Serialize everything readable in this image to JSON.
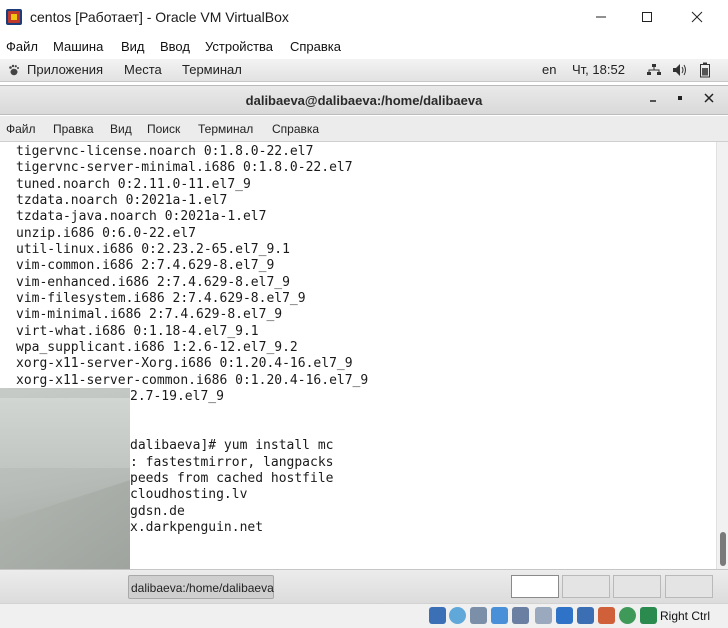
{
  "vbox": {
    "title": "centos [Работает] - Oracle VM VirtualBox",
    "menu": [
      "Файл",
      "Машина",
      "Вид",
      "Ввод",
      "Устройства",
      "Справка"
    ],
    "host_key": "Right Ctrl"
  },
  "gnome_panel": {
    "applications": "Приложения",
    "places": "Места",
    "terminal": "Терминал",
    "language": "en",
    "clock": "Чт, 18:52"
  },
  "terminal": {
    "title": "dalibaeva@dalibaeva:/home/dalibaeva",
    "menu": [
      "Файл",
      "Правка",
      "Вид",
      "Поиск",
      "Терминал",
      "Справка"
    ],
    "lines": [
      "tigervnc-license.noarch 0:1.8.0-22.el7",
      "tigervnc-server-minimal.i686 0:1.8.0-22.el7",
      "tuned.noarch 0:2.11.0-11.el7_9",
      "tzdata.noarch 0:2021a-1.el7",
      "tzdata-java.noarch 0:2021a-1.el7",
      "unzip.i686 0:6.0-22.el7",
      "util-linux.i686 0:2.23.2-65.el7_9.1",
      "vim-common.i686 2:7.4.629-8.el7_9",
      "vim-enhanced.i686 2:7.4.629-8.el7_9",
      "vim-filesystem.i686 2:7.4.629-8.el7_9",
      "vim-minimal.i686 2:7.4.629-8.el7_9",
      "virt-what.i686 0:1.18-4.el7_9.1",
      "wpa_supplicant.i686 1:2.6-12.el7_9.2",
      "xorg-x11-server-Xorg.i686 0:1.20.4-16.el7_9",
      "xorg-x11-server-common.i686 0:1.20.4-16.el7_9",
      "2.7-19.el7_9",
      "",
      "dalibaeva]# yum install mc",
      ": fastestmirror, langpacks",
      "peeds from cached hostfile",
      "cloudhosting.lv",
      "gdsn.de",
      "x.darkpenguin.net"
    ]
  },
  "taskbar": {
    "window_label": "dalibaeva:/home/dalibaeva"
  }
}
